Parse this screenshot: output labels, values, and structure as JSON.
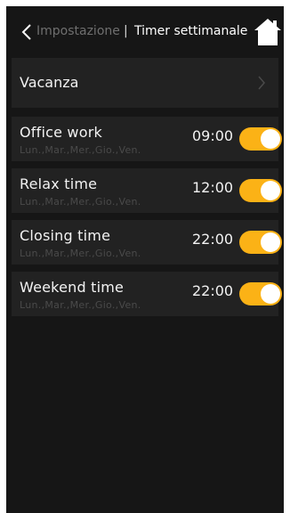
{
  "header": {
    "parent_label": "Impostazione",
    "separator": "|",
    "title": "Timer settimanale",
    "back_icon": "chevron-left-icon",
    "home_icon": "home-icon"
  },
  "vacation": {
    "label": "Vacanza",
    "icon": "chevron-right-icon"
  },
  "timers": [
    {
      "name": "Office work",
      "days": "Lun.,Mar.,Mer.,Gio.,Ven.",
      "time": "09:00",
      "enabled": true
    },
    {
      "name": "Relax time",
      "days": "Lun.,Mar.,Mer.,Gio.,Ven.",
      "time": "12:00",
      "enabled": true
    },
    {
      "name": "Closing time",
      "days": "Lun.,Mar.,Mer.,Gio.,Ven.",
      "time": "22:00",
      "enabled": true
    },
    {
      "name": "Weekend time",
      "days": "Lun.,Mar.,Mer.,Gio.,Ven.",
      "time": "22:00",
      "enabled": true
    }
  ],
  "colors": {
    "background": "#161616",
    "row": "#222222",
    "toggle_on": "#fbb216"
  }
}
